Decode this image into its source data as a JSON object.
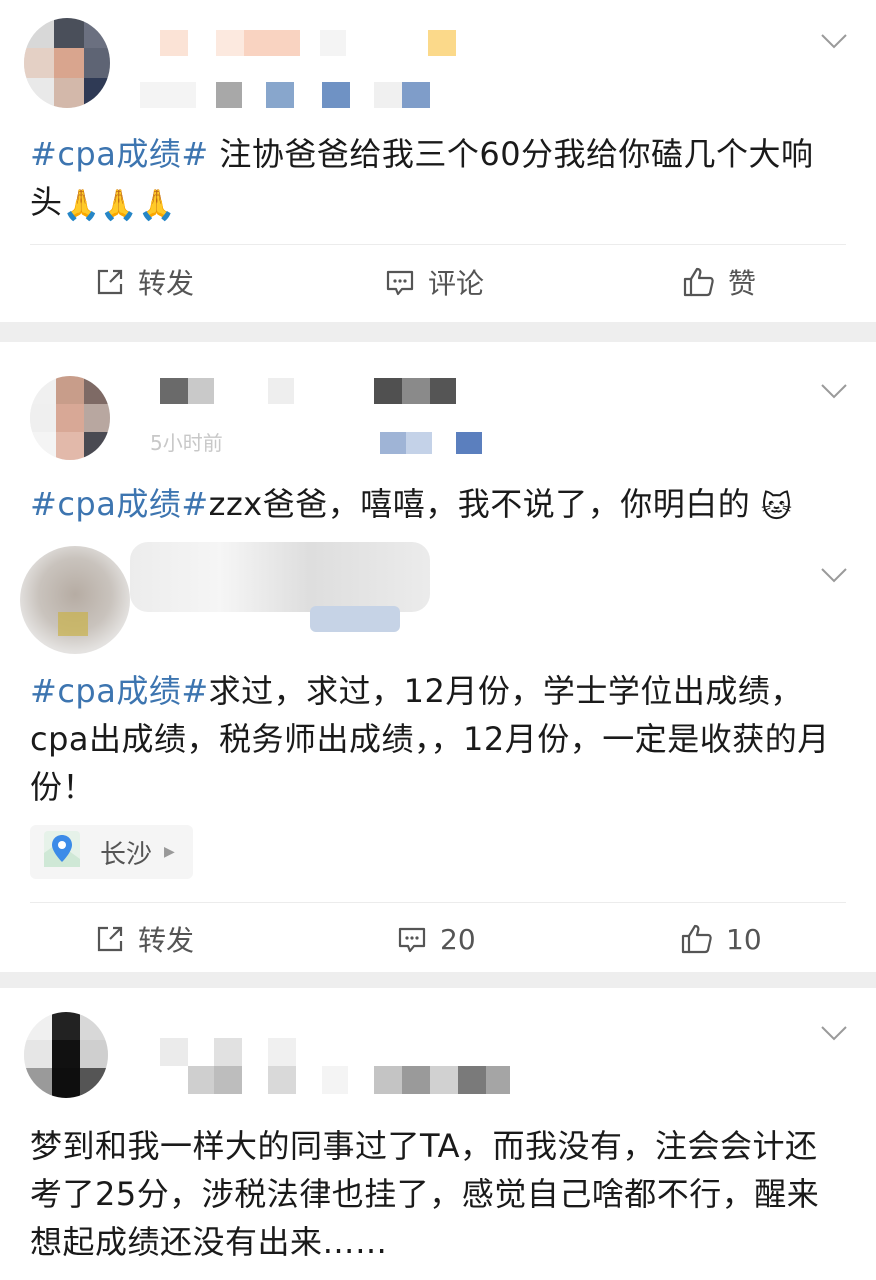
{
  "posts": [
    {
      "content_tag": "#cpa成绩#",
      "content_text": " 注协爸爸给我三个60分我给你磕几个大响头",
      "emoji": "🙏🙏🙏",
      "actions": {
        "repost": "转发",
        "comment": "评论",
        "like": "赞"
      }
    },
    {
      "content_tag": "#cpa成绩#",
      "content_text": "zzx爸爸，嘻嘻，我不说了，你明白的",
      "emoji": "🐱",
      "meta_text": "5小时前"
    },
    {
      "content_tag": "#cpa成绩#",
      "content_text": "求过，求过，12月份，学士学位出成绩，cpa出成绩，税务师出成绩，，12月份，一定是收获的月份！",
      "location": "长沙",
      "actions": {
        "repost": "转发",
        "comment": "20",
        "like": "10"
      }
    },
    {
      "content_text": "梦到和我一样大的同事过了TA，而我没有，注会会计还考了25分，涉税法律也挂了，感觉自己啥都不行，醒来想起成绩还没有出来……"
    }
  ],
  "colors": {
    "tag": "#3d75b0",
    "action_text": "#555555",
    "separator": "#eeeeee"
  },
  "icons": [
    "chevron-down-icon",
    "repost-icon",
    "comment-icon",
    "like-icon",
    "location-pin-icon"
  ]
}
